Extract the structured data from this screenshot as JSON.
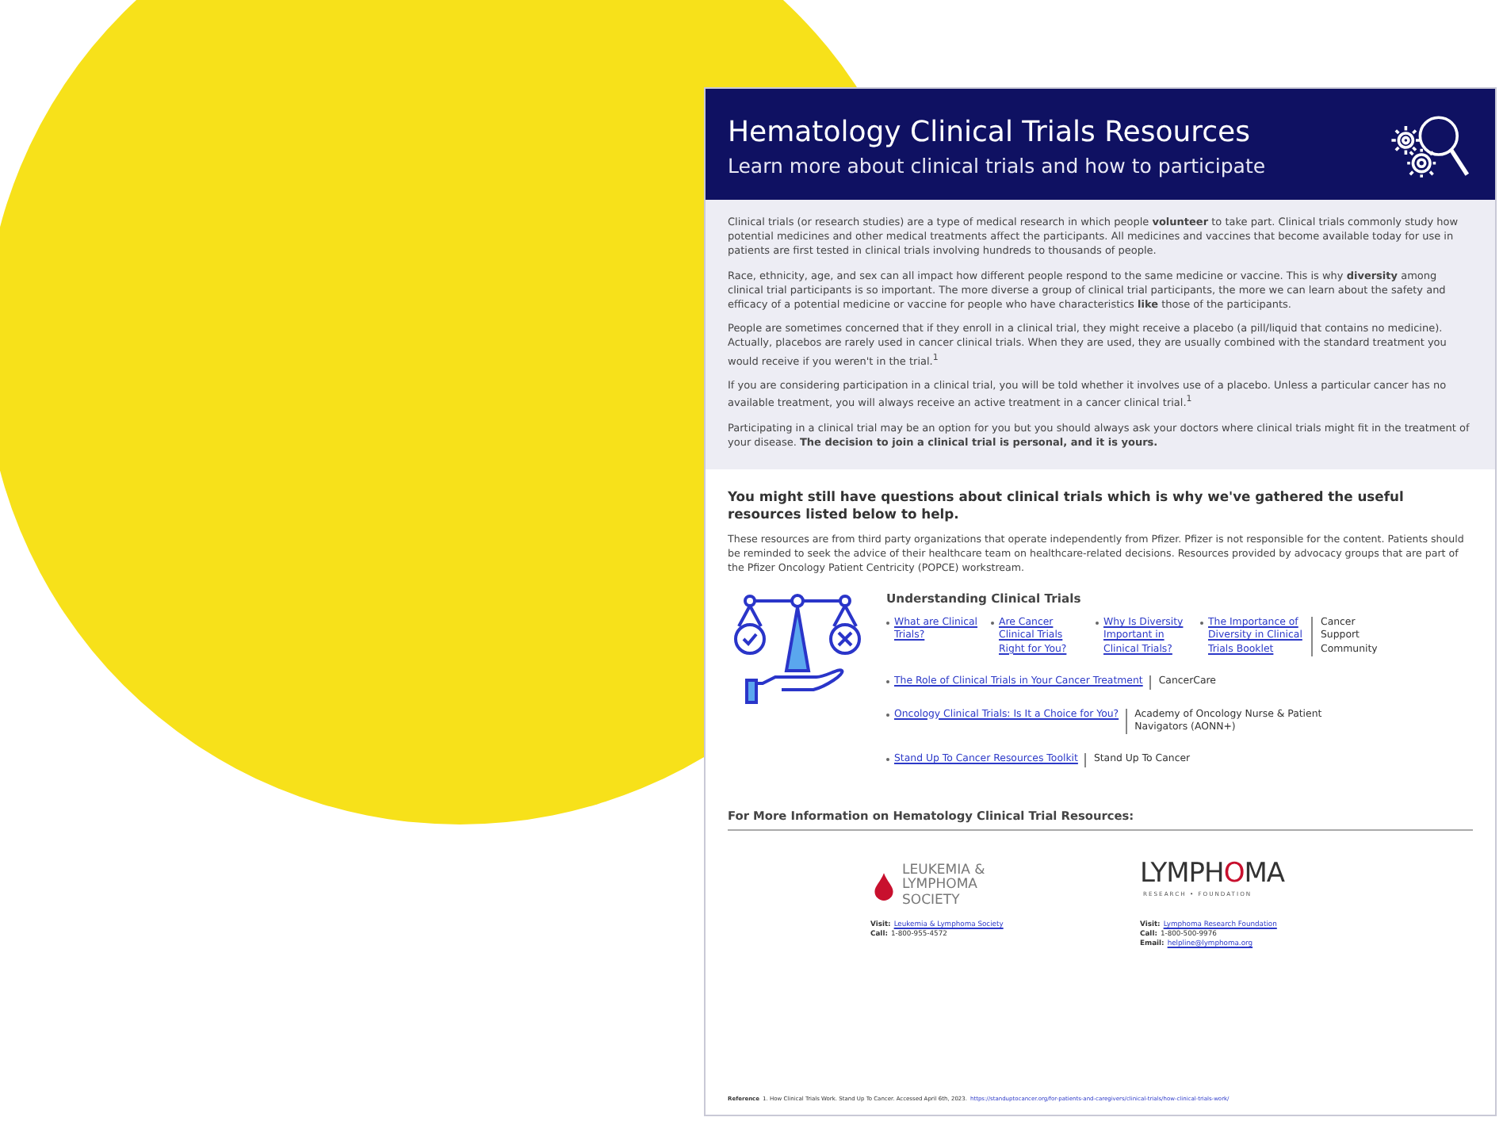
{
  "header": {
    "title": "Hematology Clinical Trials Resources",
    "subtitle": "Learn more about clinical trials and how to participate"
  },
  "intro_paragraphs": [
    "Clinical trials (or research studies) are a type of medical research in which people **volunteer** to take part. Clinical trials commonly study how potential medicines and other medical treatments affect the participants. All medicines and vaccines that become available today for use in patients are first tested in clinical trials involving hundreds to thousands of people.",
    "Race, ethnicity, age, and sex can all impact how different people respond to the same medicine or vaccine. This is why **diversity** among clinical trial participants is so important. The more diverse a group of clinical trial participants, the more we can learn about the safety and efficacy of a potential medicine or vaccine for people who have characteristics **like** those of the participants.",
    "People are sometimes concerned that if they enroll in a clinical trial, they might receive a placebo (a pill/liquid that contains no medicine). Actually, placebos are rarely used in cancer clinical trials. When they are used, they are usually combined with the standard treatment you would receive if you weren't in the trial.$^{1}$",
    "If you are considering participation in a clinical trial, you will be told whether it involves use of a placebo. Unless a particular cancer has no available treatment, you will always receive an active treatment in a cancer clinical trial.$^{1}$",
    "Participating in a clinical trial may be an option for you but you should always ask your doctors where clinical trials might fit in the treatment of your disease. **The decision to join a clinical trial is personal, and it is yours.**"
  ],
  "resources": {
    "heading": "You might still have questions about clinical trials which is why we've gathered the useful resources listed below to help.",
    "disclaimer": "These resources are from third party organizations that operate independently from Pfizer. Pfizer is not responsible for the content. Patients should be reminded to seek the advice of their healthcare team on healthcare-related decisions. Resources provided by advocacy groups that are part of the Pfizer Oncology Patient Centricity (POPCE) workstream.",
    "section_title": "Understanding Clinical Trials",
    "groups": [
      {
        "links": [
          "What are Clinical Trials?",
          "Are Cancer Clinical Trials Right for You?",
          "Why Is Diversity Important in Clinical Trials?",
          "The Importance of Diversity in Clinical Trials Booklet"
        ],
        "source": "Cancer Support Community"
      },
      {
        "links": [
          "The Role of Clinical Trials in Your Cancer Treatment"
        ],
        "source": "CancerCare"
      },
      {
        "links": [
          "Oncology Clinical Trials: Is It a Choice for You?"
        ],
        "source": "Academy of Oncology Nurse & Patient Navigators (AONN+)"
      },
      {
        "links": [
          "Stand Up To Cancer Resources Toolkit"
        ],
        "source": "Stand Up To Cancer"
      }
    ]
  },
  "more_info": {
    "heading": "For More Information on Hematology Clinical Trial Resources:",
    "orgs": [
      {
        "kind": "drop",
        "logo_lines": [
          "LEUKEMIA &",
          "LYMPHOMA",
          "SOCIETY"
        ],
        "contacts": [
          {
            "label": "Visit:",
            "value": "Leukemia & Lymphoma Society",
            "kind": "link"
          },
          {
            "label": "Call:",
            "value": "1-800-955-4572",
            "kind": "text"
          }
        ]
      },
      {
        "kind": "wordmark",
        "logo_parts": [
          {
            "text": "LYMPH",
            "accent": false
          },
          {
            "text": "O",
            "accent": true
          },
          {
            "text": "MA",
            "accent": false
          }
        ],
        "tagline": "RESEARCH • FOUNDATION",
        "contacts": [
          {
            "label": "Visit:",
            "value": "Lymphoma Research Foundation",
            "kind": "link"
          },
          {
            "label": "Call:",
            "value": "1-800-500-9976",
            "kind": "text"
          },
          {
            "label": "Email:",
            "value": "helpline@lymphoma.org",
            "kind": "link"
          }
        ]
      }
    ]
  },
  "reference": {
    "label": "Reference",
    "text": "1. How Clinical Trials Work. Stand Up To Cancer. Accessed April 6th, 2023.",
    "url": "https://standuptocancer.org/for-patients-and-caregivers/clinical-trials/how-clinical-trials-work/"
  }
}
